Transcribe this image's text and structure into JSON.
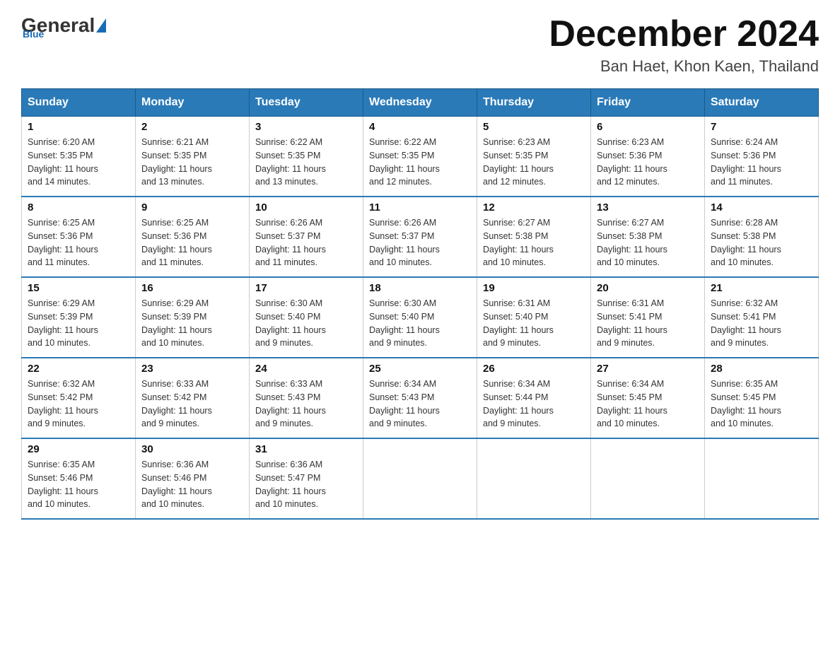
{
  "logo": {
    "general": "General",
    "blue": "Blue"
  },
  "header": {
    "title": "December 2024",
    "location": "Ban Haet, Khon Kaen, Thailand"
  },
  "days_of_week": [
    "Sunday",
    "Monday",
    "Tuesday",
    "Wednesday",
    "Thursday",
    "Friday",
    "Saturday"
  ],
  "weeks": [
    [
      {
        "day": "1",
        "info": "Sunrise: 6:20 AM\nSunset: 5:35 PM\nDaylight: 11 hours\nand 14 minutes."
      },
      {
        "day": "2",
        "info": "Sunrise: 6:21 AM\nSunset: 5:35 PM\nDaylight: 11 hours\nand 13 minutes."
      },
      {
        "day": "3",
        "info": "Sunrise: 6:22 AM\nSunset: 5:35 PM\nDaylight: 11 hours\nand 13 minutes."
      },
      {
        "day": "4",
        "info": "Sunrise: 6:22 AM\nSunset: 5:35 PM\nDaylight: 11 hours\nand 12 minutes."
      },
      {
        "day": "5",
        "info": "Sunrise: 6:23 AM\nSunset: 5:35 PM\nDaylight: 11 hours\nand 12 minutes."
      },
      {
        "day": "6",
        "info": "Sunrise: 6:23 AM\nSunset: 5:36 PM\nDaylight: 11 hours\nand 12 minutes."
      },
      {
        "day": "7",
        "info": "Sunrise: 6:24 AM\nSunset: 5:36 PM\nDaylight: 11 hours\nand 11 minutes."
      }
    ],
    [
      {
        "day": "8",
        "info": "Sunrise: 6:25 AM\nSunset: 5:36 PM\nDaylight: 11 hours\nand 11 minutes."
      },
      {
        "day": "9",
        "info": "Sunrise: 6:25 AM\nSunset: 5:36 PM\nDaylight: 11 hours\nand 11 minutes."
      },
      {
        "day": "10",
        "info": "Sunrise: 6:26 AM\nSunset: 5:37 PM\nDaylight: 11 hours\nand 11 minutes."
      },
      {
        "day": "11",
        "info": "Sunrise: 6:26 AM\nSunset: 5:37 PM\nDaylight: 11 hours\nand 10 minutes."
      },
      {
        "day": "12",
        "info": "Sunrise: 6:27 AM\nSunset: 5:38 PM\nDaylight: 11 hours\nand 10 minutes."
      },
      {
        "day": "13",
        "info": "Sunrise: 6:27 AM\nSunset: 5:38 PM\nDaylight: 11 hours\nand 10 minutes."
      },
      {
        "day": "14",
        "info": "Sunrise: 6:28 AM\nSunset: 5:38 PM\nDaylight: 11 hours\nand 10 minutes."
      }
    ],
    [
      {
        "day": "15",
        "info": "Sunrise: 6:29 AM\nSunset: 5:39 PM\nDaylight: 11 hours\nand 10 minutes."
      },
      {
        "day": "16",
        "info": "Sunrise: 6:29 AM\nSunset: 5:39 PM\nDaylight: 11 hours\nand 10 minutes."
      },
      {
        "day": "17",
        "info": "Sunrise: 6:30 AM\nSunset: 5:40 PM\nDaylight: 11 hours\nand 9 minutes."
      },
      {
        "day": "18",
        "info": "Sunrise: 6:30 AM\nSunset: 5:40 PM\nDaylight: 11 hours\nand 9 minutes."
      },
      {
        "day": "19",
        "info": "Sunrise: 6:31 AM\nSunset: 5:40 PM\nDaylight: 11 hours\nand 9 minutes."
      },
      {
        "day": "20",
        "info": "Sunrise: 6:31 AM\nSunset: 5:41 PM\nDaylight: 11 hours\nand 9 minutes."
      },
      {
        "day": "21",
        "info": "Sunrise: 6:32 AM\nSunset: 5:41 PM\nDaylight: 11 hours\nand 9 minutes."
      }
    ],
    [
      {
        "day": "22",
        "info": "Sunrise: 6:32 AM\nSunset: 5:42 PM\nDaylight: 11 hours\nand 9 minutes."
      },
      {
        "day": "23",
        "info": "Sunrise: 6:33 AM\nSunset: 5:42 PM\nDaylight: 11 hours\nand 9 minutes."
      },
      {
        "day": "24",
        "info": "Sunrise: 6:33 AM\nSunset: 5:43 PM\nDaylight: 11 hours\nand 9 minutes."
      },
      {
        "day": "25",
        "info": "Sunrise: 6:34 AM\nSunset: 5:43 PM\nDaylight: 11 hours\nand 9 minutes."
      },
      {
        "day": "26",
        "info": "Sunrise: 6:34 AM\nSunset: 5:44 PM\nDaylight: 11 hours\nand 9 minutes."
      },
      {
        "day": "27",
        "info": "Sunrise: 6:34 AM\nSunset: 5:45 PM\nDaylight: 11 hours\nand 10 minutes."
      },
      {
        "day": "28",
        "info": "Sunrise: 6:35 AM\nSunset: 5:45 PM\nDaylight: 11 hours\nand 10 minutes."
      }
    ],
    [
      {
        "day": "29",
        "info": "Sunrise: 6:35 AM\nSunset: 5:46 PM\nDaylight: 11 hours\nand 10 minutes."
      },
      {
        "day": "30",
        "info": "Sunrise: 6:36 AM\nSunset: 5:46 PM\nDaylight: 11 hours\nand 10 minutes."
      },
      {
        "day": "31",
        "info": "Sunrise: 6:36 AM\nSunset: 5:47 PM\nDaylight: 11 hours\nand 10 minutes."
      },
      null,
      null,
      null,
      null
    ]
  ]
}
